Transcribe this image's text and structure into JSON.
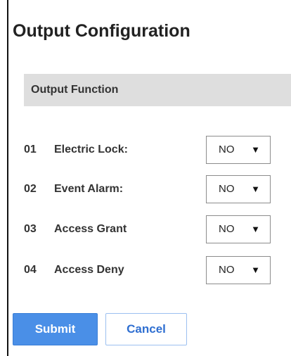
{
  "page": {
    "title": "Output Configuration"
  },
  "section": {
    "title": "Output Function"
  },
  "outputs": [
    {
      "number": "01",
      "label": "Electric Lock:",
      "value": "NO"
    },
    {
      "number": "02",
      "label": "Event Alarm:",
      "value": "NO"
    },
    {
      "number": "03",
      "label": "Access Grant",
      "value": "NO"
    },
    {
      "number": "04",
      "label": "Access Deny",
      "value": "NO"
    }
  ],
  "select": {
    "arrow": "▼"
  },
  "buttons": {
    "submit": "Submit",
    "cancel": "Cancel"
  },
  "colors": {
    "submit_bg": "#4a8fe7",
    "cancel_text": "#2f6fd1",
    "section_bg": "#dedede"
  }
}
